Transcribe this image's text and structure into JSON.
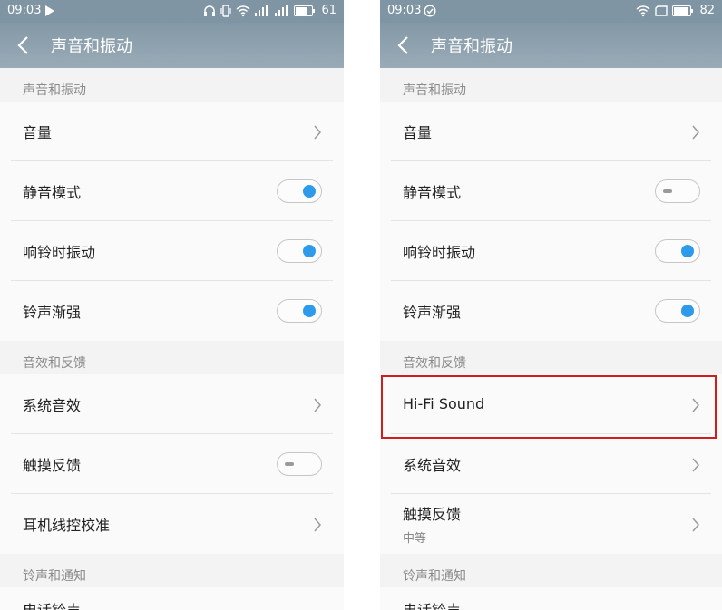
{
  "colors": {
    "accent": "#2e9bea",
    "highlight": "#d01c1c",
    "header": "#8398a6"
  },
  "left": {
    "status": {
      "time": "09:03",
      "battery": "61",
      "icons": [
        "play-icon",
        "headphones-icon",
        "vibrate-icon",
        "wifi-icon",
        "signal-icon",
        "signal-icon",
        "battery-icon"
      ]
    },
    "title": "声音和振动",
    "sections": [
      {
        "header": "声音和振动",
        "rows": [
          {
            "label": "音量",
            "control": "chevron"
          },
          {
            "label": "静音模式",
            "control": "toggle",
            "on": true
          },
          {
            "label": "响铃时振动",
            "control": "toggle",
            "on": true
          },
          {
            "label": "铃声渐强",
            "control": "toggle",
            "on": true
          }
        ]
      },
      {
        "header": "音效和反馈",
        "rows": [
          {
            "label": "系统音效",
            "control": "chevron"
          },
          {
            "label": "触摸反馈",
            "control": "toggle",
            "on": false
          },
          {
            "label": "耳机线控校准",
            "control": "chevron"
          }
        ]
      },
      {
        "header": "铃声和通知",
        "rows": [
          {
            "label": "电话铃声",
            "partial": true
          }
        ]
      }
    ]
  },
  "right": {
    "status": {
      "time": "09:03",
      "battery": "82",
      "icons": [
        "check-circle-icon",
        "wifi-icon",
        "battery-icon"
      ]
    },
    "title": "声音和振动",
    "sections": [
      {
        "header": "声音和振动",
        "rows": [
          {
            "label": "音量",
            "control": "chevron"
          },
          {
            "label": "静音模式",
            "control": "toggle",
            "on": false
          },
          {
            "label": "响铃时振动",
            "control": "toggle",
            "on": true
          },
          {
            "label": "铃声渐强",
            "control": "toggle",
            "on": true
          }
        ]
      },
      {
        "header": "音效和反馈",
        "rows": [
          {
            "label": "Hi-Fi Sound",
            "control": "chevron"
          },
          {
            "label": "系统音效",
            "control": "chevron"
          },
          {
            "label": "触摸反馈",
            "sub": "中等",
            "control": "chevron"
          }
        ]
      },
      {
        "header": "铃声和通知",
        "rows": [
          {
            "label": "电话铃声",
            "partial": true
          }
        ]
      }
    ]
  }
}
